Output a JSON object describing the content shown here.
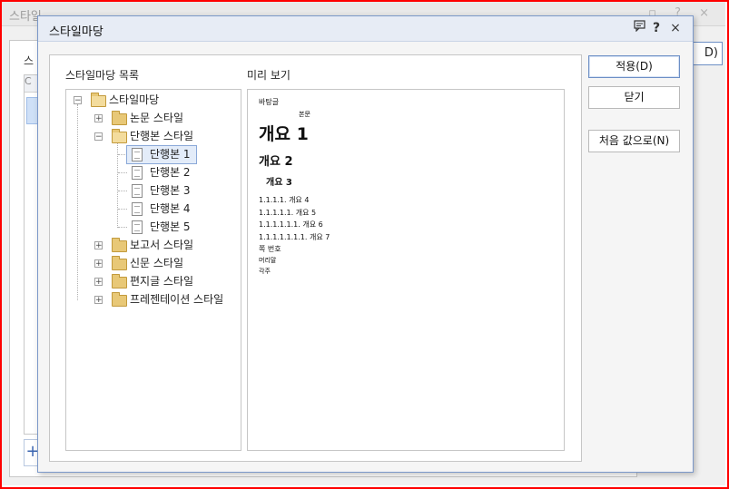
{
  "background_dialog": {
    "title": "스타일",
    "label": "스",
    "list_header": "C",
    "right_button": "D)",
    "bottom_button": "+"
  },
  "dialog": {
    "title": "스타일마당",
    "icons": {
      "feedback": "comment-icon",
      "help": "?",
      "close": "×"
    }
  },
  "labels": {
    "list": "스타일마당 목록",
    "preview": "미리 보기"
  },
  "tree": {
    "root": "스타일마당",
    "items": [
      {
        "label": "논문 스타일",
        "expanded": false
      },
      {
        "label": "단행본 스타일",
        "expanded": true,
        "children": [
          "단행본 1",
          "단행본 2",
          "단행본 3",
          "단행본 4",
          "단행본 5"
        ]
      },
      {
        "label": "보고서 스타일",
        "expanded": false
      },
      {
        "label": "신문 스타일",
        "expanded": false
      },
      {
        "label": "편지글 스타일",
        "expanded": false
      },
      {
        "label": "프레젠테이션 스타일",
        "expanded": false
      }
    ],
    "selected": "단행본 1"
  },
  "preview": {
    "body": "바탕글",
    "body2": "본문",
    "outline1": "개요 1",
    "outline2": "개요 2",
    "outline3": "개요 3",
    "outline4": "1.1.1.1.   개요 4",
    "outline5": "1.1.1.1.1.   개요 5",
    "outline6": "1.1.1.1.1.1.   개요 6",
    "outline7": "1.1.1.1.1.1.1.   개요 7",
    "page_number": "쪽 번호",
    "header": "머리말",
    "footnote": "각주"
  },
  "buttons": {
    "apply": "적용(D)",
    "close": "닫기",
    "reset": "처음 값으로(N)"
  }
}
